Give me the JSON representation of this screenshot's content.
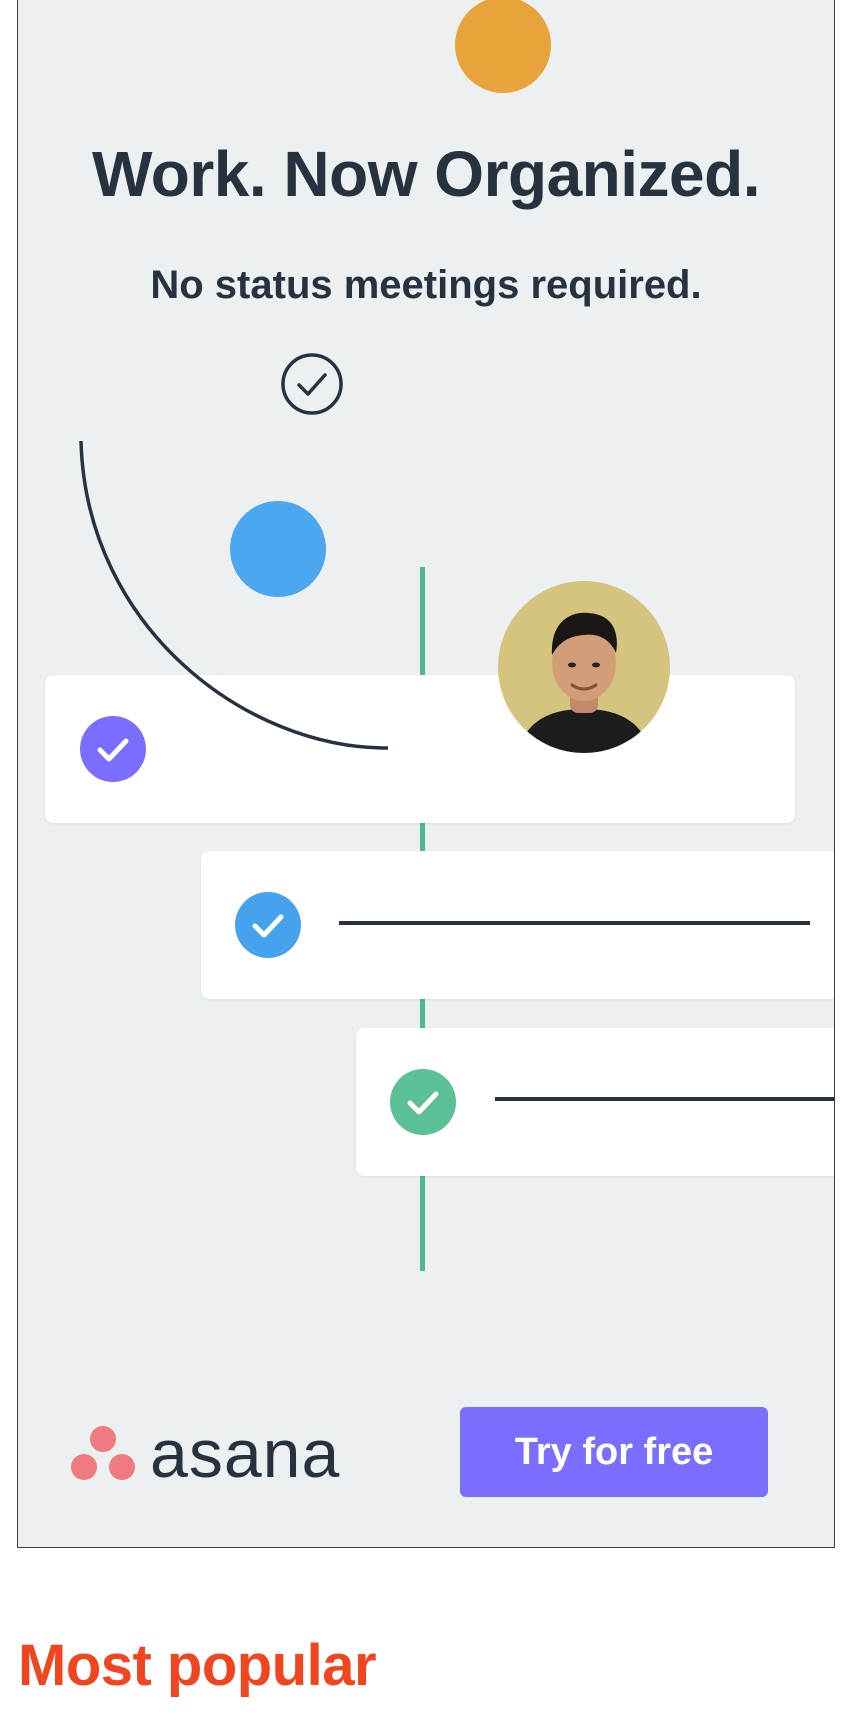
{
  "ad": {
    "headline": "Work. Now Organized.",
    "subheadline": "No status meetings required.",
    "brand_name": "asana",
    "cta_label": "Try for free",
    "colors": {
      "background": "#edf0f1",
      "text": "#273240",
      "orange": "#e8a33b",
      "blue": "#4aa7f0",
      "timeline": "#4fb892",
      "purple": "#796eff",
      "check_blue": "#44a3ec",
      "check_green": "#5bbf97",
      "brand_coral": "#f07a7f"
    },
    "icons": [
      "check-circle-icon",
      "avatar-photo",
      "asana-logo-icon"
    ]
  },
  "section": {
    "title": "Most popular",
    "color": "#f0451f"
  }
}
